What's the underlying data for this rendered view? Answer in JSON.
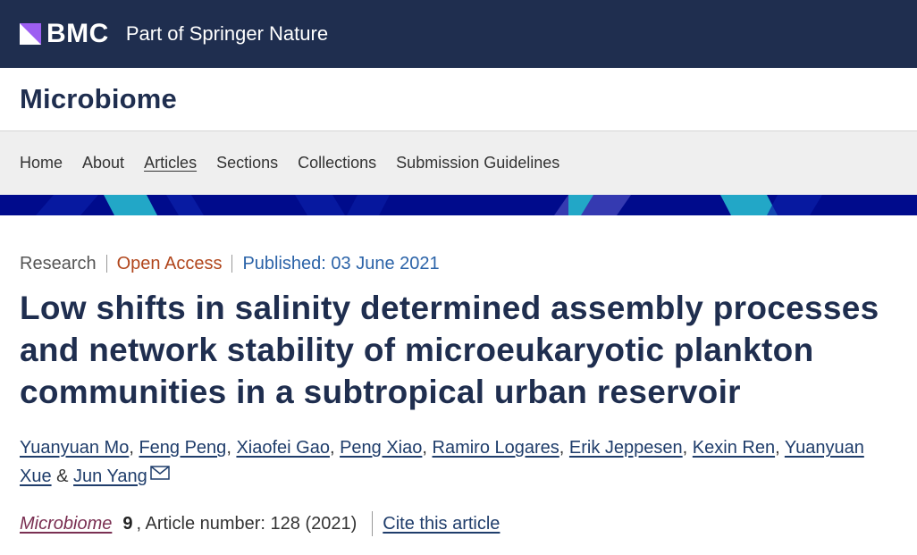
{
  "brand": {
    "logo_text": "BMC",
    "tagline": "Part of Springer Nature",
    "logo_mark_color": "#9d5ff2"
  },
  "journal": {
    "title": "Microbiome"
  },
  "nav": {
    "items": [
      {
        "label": "Home"
      },
      {
        "label": "About"
      },
      {
        "label": "Articles"
      },
      {
        "label": "Sections"
      },
      {
        "label": "Collections"
      },
      {
        "label": "Submission Guidelines"
      }
    ],
    "current": "Articles"
  },
  "article": {
    "type": "Research",
    "access": "Open Access",
    "published": "Published: 03 June 2021",
    "title": "Low shifts in salinity determined assembly processes and network stability of microeukaryotic plankton communities in a subtropical urban reservoir",
    "authors": [
      {
        "name": "Yuanyuan Mo",
        "sep": ", "
      },
      {
        "name": "Feng Peng",
        "sep": ", "
      },
      {
        "name": "Xiaofei Gao",
        "sep": ", "
      },
      {
        "name": "Peng Xiao",
        "sep": ", "
      },
      {
        "name": "Ramiro Logares",
        "sep": ", "
      },
      {
        "name": "Erik Jeppesen",
        "sep": ", "
      },
      {
        "name": "Kexin Ren",
        "sep": ", "
      },
      {
        "name": "Yuanyuan Xue",
        "sep": " & "
      },
      {
        "name": "Jun Yang",
        "sep": ""
      }
    ],
    "citation": {
      "journal": "Microbiome",
      "volume": "9",
      "article_number": ", Article number: 128 (2021)",
      "cite_label": "Cite this article"
    }
  },
  "colors": {
    "brand_bar": "#1f2e4f",
    "accent_navy": "#000b8c",
    "accent_cyan": "#22a7c7",
    "open_access": "#b1461c",
    "published": "#2b63a8"
  }
}
